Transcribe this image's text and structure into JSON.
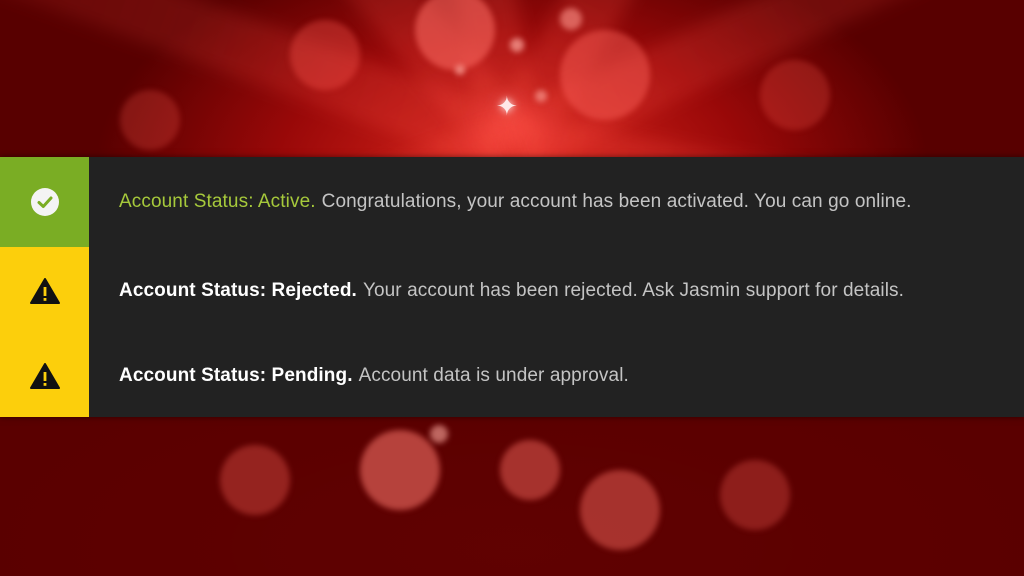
{
  "colors": {
    "panel_background": "#222222",
    "active_accent": "#7aad24",
    "warning_accent": "#fccf0c",
    "active_label_text": "#a6c93b"
  },
  "notifications": [
    {
      "status": "active",
      "icon": "check-circle-icon",
      "label": "Account Status: Active.",
      "message": "Congratulations, your account has been activated. You can go online."
    },
    {
      "status": "rejected",
      "icon": "warning-triangle-icon",
      "label": "Account Status: Rejected.",
      "message": "Your account has been rejected. Ask Jasmin support for details."
    },
    {
      "status": "pending",
      "icon": "warning-triangle-icon",
      "label": "Account Status: Pending.",
      "message": "Account data is under approval."
    }
  ]
}
